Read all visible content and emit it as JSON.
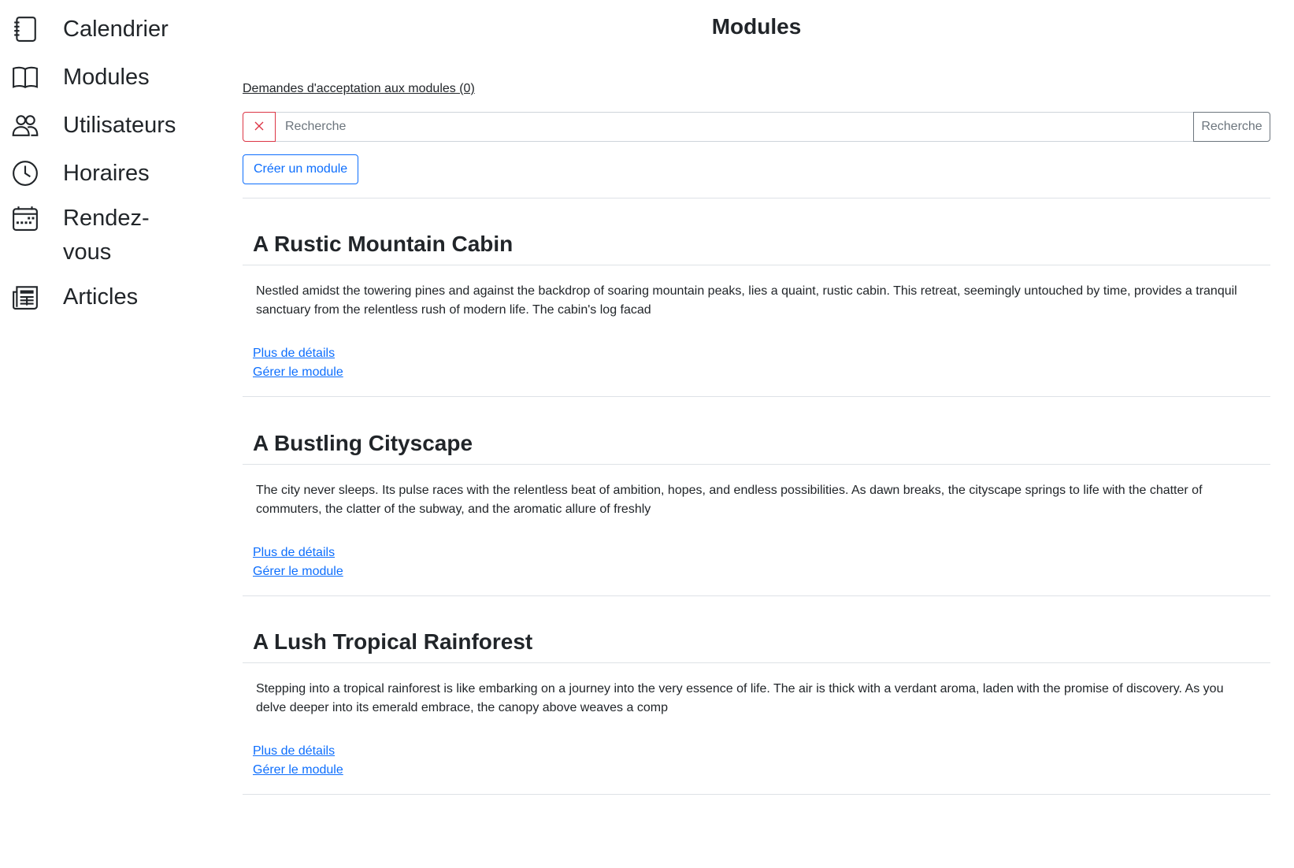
{
  "sidebar": {
    "items": [
      {
        "label": "Calendrier",
        "icon": "journal-icon"
      },
      {
        "label": "Modules",
        "icon": "book-icon"
      },
      {
        "label": "Utilisateurs",
        "icon": "people-icon"
      },
      {
        "label": "Horaires",
        "icon": "clock-icon"
      },
      {
        "label": "Rendez-vous",
        "icon": "calendar-week-icon"
      },
      {
        "label": "Articles",
        "icon": "newspaper-icon"
      }
    ]
  },
  "main": {
    "title": "Modules",
    "requests_link": "Demandes d'acceptation aux modules (0)",
    "search": {
      "placeholder": "Recherche",
      "value": "",
      "clear_icon": "x-icon",
      "button_label": "Recherche"
    },
    "create_button": "Créer un module",
    "modules": [
      {
        "title": "A Rustic Mountain Cabin",
        "description": "Nestled amidst the towering pines and against the backdrop of soaring mountain peaks, lies a quaint, rustic cabin. This retreat, seemingly untouched by time, provides a tranquil sanctuary from the relentless rush of modern life. The cabin's log facad",
        "details_link": "Plus de détails",
        "manage_link": "Gérer le module"
      },
      {
        "title": "A Bustling Cityscape",
        "description": "The city never sleeps. Its pulse races with the relentless beat of ambition, hopes, and endless possibilities. As dawn breaks, the cityscape springs to life with the chatter of commuters, the clatter of the subway, and the aromatic allure of freshly",
        "details_link": "Plus de détails",
        "manage_link": "Gérer le module"
      },
      {
        "title": "A Lush Tropical Rainforest",
        "description": "Stepping into a tropical rainforest is like embarking on a journey into the very essence of life. The air is thick with a verdant aroma, laden with the promise of discovery. As you delve deeper into its emerald embrace, the canopy above weaves a comp",
        "details_link": "Plus de détails",
        "manage_link": "Gérer le module"
      }
    ]
  },
  "colors": {
    "link": "#0d6efd",
    "danger": "#dc3545",
    "secondary": "#6c757d",
    "divider": "#dee2e6",
    "text": "#212529"
  }
}
